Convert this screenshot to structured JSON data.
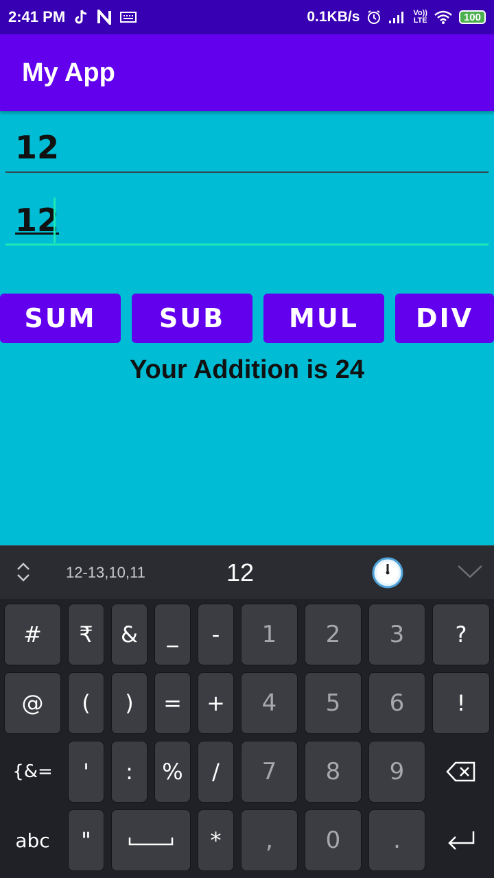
{
  "status_bar": {
    "time": "2:41 PM",
    "net_speed": "0.1KB/s",
    "network": "LTE",
    "volte": "Vo))",
    "battery": "100"
  },
  "app_bar": {
    "title": "My App"
  },
  "inputs": {
    "first_value": "12",
    "second_value": "12"
  },
  "buttons": {
    "sum": "SUM",
    "sub": "SUB",
    "mul": "MUL",
    "div": "DIV"
  },
  "result_text": "Your Addition is 24",
  "keyboard": {
    "suggestions": {
      "left": "12-13,10,11",
      "center": "12"
    },
    "rows": [
      [
        "#",
        "₹",
        "&",
        "_",
        "-",
        "1",
        "2",
        "3",
        "?"
      ],
      [
        "@",
        "(",
        ")",
        "=",
        "+",
        "4",
        "5",
        "6",
        "!"
      ],
      [
        "{&=",
        "'",
        ":",
        "%",
        "/",
        "7",
        "8",
        "9"
      ],
      [
        "abc",
        "\"",
        "*",
        ",",
        "0",
        "."
      ]
    ]
  },
  "colors": {
    "status_bar": "#3700b3",
    "primary": "#6200ee",
    "background": "#00bcd4",
    "accent": "#1de9b6"
  }
}
